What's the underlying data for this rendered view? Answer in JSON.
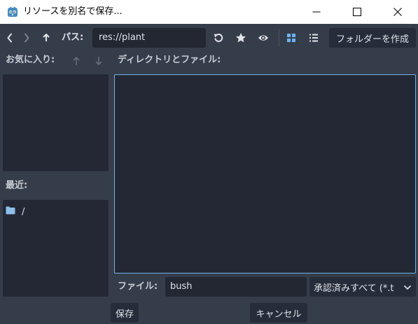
{
  "window": {
    "title": "リソースを別名で保存...",
    "icon": "godot-icon",
    "controls": [
      "minimize-icon",
      "maximize-icon",
      "close-icon"
    ]
  },
  "toolbar": {
    "back_icon": "chevron-left-icon",
    "forward_icon": "chevron-right-icon",
    "up_icon": "arrow-up-icon",
    "path_label": "パス:",
    "path_value": "res://plant",
    "refresh_icon": "reload-icon",
    "favorite_icon": "star-icon",
    "hidden_files_icon": "eye-icon",
    "grid_view_icon": "grid-icon",
    "list_view_icon": "list-icon",
    "create_folder_label": "フォルダーを作成"
  },
  "favorites": {
    "label": "お気に入り:",
    "move_up_icon": "arrow-up-icon",
    "move_down_icon": "arrow-down-icon",
    "items": []
  },
  "recent": {
    "label": "最近:",
    "items": [
      {
        "icon": "folder-icon",
        "label": "/"
      }
    ]
  },
  "main": {
    "label": "ディレクトリとファイル:",
    "items": []
  },
  "footer": {
    "file_label": "ファイル:",
    "file_value": "bush",
    "filter_selected": "承認済みすべて (*.t",
    "save_label": "保存",
    "cancel_label": "キャンセル"
  },
  "colors": {
    "background": "#363d4a",
    "panel": "#232834",
    "input": "#222732",
    "button": "#262c39",
    "focus_border": "#6fb3ea",
    "active_view_icon": "#6cb2f0",
    "folder_icon": "#8fbfea"
  }
}
